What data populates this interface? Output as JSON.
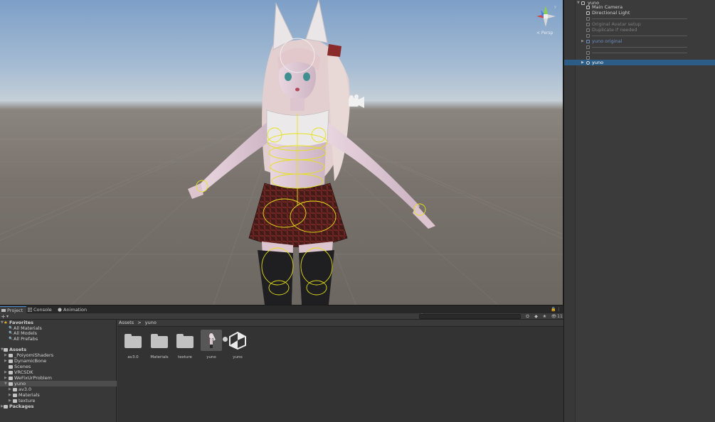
{
  "scene": {
    "gizmo_label": "< Persp",
    "gizmo_axes": [
      "x-axis-red",
      "y-axis-green",
      "z-axis-blue"
    ]
  },
  "hierarchy": {
    "scene_name": "yuno",
    "items": [
      {
        "label": "Main Camera",
        "style": "normal"
      },
      {
        "label": "Directional Light",
        "style": "normal"
      },
      {
        "label": "",
        "style": "separator"
      },
      {
        "label": "Original Avatar setup",
        "style": "dim"
      },
      {
        "label": "Duplicate if needed",
        "style": "dim"
      },
      {
        "label": "",
        "style": "separator"
      },
      {
        "label": "yuno original",
        "style": "blue"
      },
      {
        "label": "",
        "style": "separator"
      },
      {
        "label": "",
        "style": "separator"
      },
      {
        "label": "yuno",
        "style": "selected"
      }
    ]
  },
  "bottom_panel": {
    "tabs": [
      {
        "label": "Project",
        "icon": "folder-icon",
        "active": true
      },
      {
        "label": "Console",
        "icon": "console-icon",
        "active": false
      },
      {
        "label": "Animation",
        "icon": "animation-icon",
        "active": false
      }
    ],
    "toolbar": {
      "add_label": "+",
      "search_placeholder": "",
      "hidden_count": "11"
    },
    "project_tree": {
      "favorites": {
        "label": "Favorites",
        "items": [
          "All Materials",
          "All Models",
          "All Prefabs"
        ]
      },
      "assets": {
        "label": "Assets",
        "items": [
          {
            "label": "_PoiyomiShaders",
            "depth": 1
          },
          {
            "label": "DynamicBone",
            "depth": 1
          },
          {
            "label": "Scenes",
            "depth": 1
          },
          {
            "label": "VRCSDK",
            "depth": 1
          },
          {
            "label": "WeFixUrProblem",
            "depth": 1
          },
          {
            "label": "yuno",
            "depth": 1,
            "selected": true
          },
          {
            "label": "av3.0",
            "depth": 2
          },
          {
            "label": "Materials",
            "depth": 2
          },
          {
            "label": "texture",
            "depth": 2
          }
        ]
      },
      "packages": {
        "label": "Packages"
      }
    },
    "breadcrumb": [
      "Assets",
      ">",
      "yuno"
    ],
    "grid_items": [
      {
        "label": "av3.0",
        "kind": "folder"
      },
      {
        "label": "Materials",
        "kind": "folder"
      },
      {
        "label": "texture",
        "kind": "folder"
      },
      {
        "label": "yuno",
        "kind": "prefab"
      },
      {
        "label": "yuno",
        "kind": "unity-scene"
      }
    ]
  },
  "colors": {
    "selection": "#2c5d87",
    "panel": "#383838",
    "gizmo_bone": "#e6e21a"
  }
}
